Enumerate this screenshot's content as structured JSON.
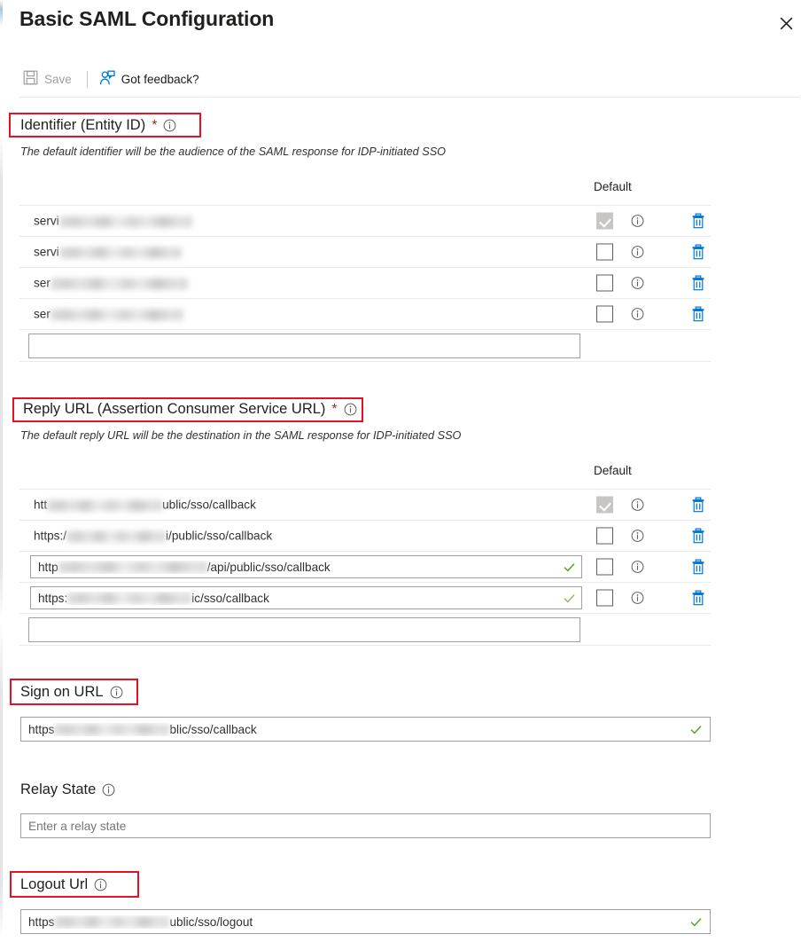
{
  "header": {
    "title": "Basic SAML Configuration",
    "close_label": "Close"
  },
  "commandbar": {
    "save_label": "Save",
    "save_disabled": true,
    "feedback_label": "Got feedback?"
  },
  "identifier": {
    "label": "Identifier (Entity ID)",
    "required_marker": "*",
    "description": "The default identifier will be the audience of the SAML response for IDP-initiated SSO",
    "column_default": "Default",
    "rows": [
      {
        "value_prefix": "servi",
        "redacted": true,
        "redaction_width": 150,
        "default_checked": true,
        "default_disabled": true
      },
      {
        "value_prefix": "servi",
        "redacted": true,
        "redaction_width": 138,
        "default_checked": false,
        "default_disabled": false
      },
      {
        "value_prefix": "ser",
        "redacted": true,
        "redaction_width": 155,
        "default_checked": false,
        "default_disabled": false
      },
      {
        "value_prefix": "ser",
        "redacted": true,
        "redaction_width": 150,
        "default_checked": false,
        "default_disabled": false
      }
    ],
    "add_placeholder": ""
  },
  "reply_url": {
    "label": "Reply URL (Assertion Consumer Service URL)",
    "required_marker": "*",
    "description": "The default reply URL will be the destination in the SAML response for IDP-initiated SSO",
    "column_default": "Default",
    "rows": [
      {
        "value_prefix": "htt",
        "redacted": true,
        "redaction_width": 130,
        "value_suffix": "ublic/sso/callback",
        "editable": false,
        "valid": false,
        "default_checked": true,
        "default_disabled": true
      },
      {
        "value_prefix": "https:/",
        "redacted": true,
        "redaction_width": 112,
        "value_suffix": "i/public/sso/callback",
        "editable": false,
        "valid": false,
        "default_checked": false,
        "default_disabled": false
      },
      {
        "value_prefix": "http",
        "redacted": true,
        "redaction_width": 168,
        "value_suffix": "/api/public/sso/callback",
        "editable": true,
        "valid": true,
        "default_checked": false,
        "default_disabled": false
      },
      {
        "value_prefix": "https:",
        "redacted": true,
        "redaction_width": 140,
        "value_suffix": "ic/sso/callback",
        "editable": true,
        "valid": true,
        "default_checked": false,
        "default_disabled": false
      }
    ],
    "add_placeholder": ""
  },
  "sign_on_url": {
    "label": "Sign on URL",
    "value_prefix": "https",
    "redacted": true,
    "redaction_width": 130,
    "value_suffix": "blic/sso/callback",
    "valid": true
  },
  "relay_state": {
    "label": "Relay State",
    "value": "",
    "placeholder": "Enter a relay state"
  },
  "logout_url": {
    "label": "Logout Url",
    "value_prefix": "https",
    "redacted": true,
    "redaction_width": 130,
    "value_suffix": "ublic/sso/logout",
    "valid": true
  },
  "icons": {
    "close": "close-icon",
    "save": "save-disk-icon",
    "feedback": "person-feedback-icon",
    "info": "info-circle-icon",
    "delete": "trash-icon",
    "valid": "green-check-icon"
  },
  "colors": {
    "accent_blue": "#0078d4",
    "highlight_red": "#e81123",
    "required_red": "#a4262c",
    "valid_green": "#5ca420",
    "text": "#201f1e",
    "muted": "#a19f9d",
    "rule": "#edebe9"
  }
}
